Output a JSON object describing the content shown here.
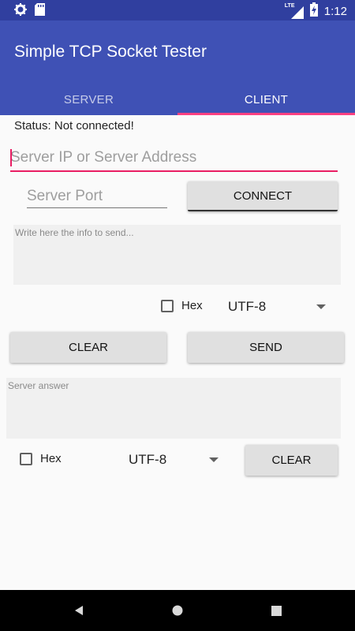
{
  "status_bar": {
    "time": "1:12",
    "network_label": "LTE",
    "icons": [
      "settings-icon",
      "sd-card-icon",
      "signal-icon",
      "battery-icon"
    ]
  },
  "app": {
    "title": "Simple TCP Socket Tester"
  },
  "tabs": [
    {
      "label": "SERVER",
      "active": false
    },
    {
      "label": "CLIENT",
      "active": true
    }
  ],
  "client": {
    "status": "Status: Not connected!",
    "server_ip": {
      "value": "",
      "placeholder": "Server IP or Server Address"
    },
    "server_port": {
      "value": "",
      "placeholder": "Server Port"
    },
    "connect_label": "CONNECT",
    "send_text": {
      "value": "",
      "placeholder": "Write here the info to send..."
    },
    "send_options": {
      "hex_label": "Hex",
      "hex_checked": false,
      "encoding": "UTF-8"
    },
    "clear_label": "CLEAR",
    "send_label": "SEND",
    "answer": {
      "value": "",
      "placeholder": "Server answer"
    },
    "answer_options": {
      "hex_label": "Hex",
      "hex_checked": false,
      "encoding": "UTF-8"
    },
    "answer_clear_label": "CLEAR"
  },
  "colors": {
    "primary": "#3F51B5",
    "primary_dark": "#303F9F",
    "accent": "#FF4081"
  }
}
